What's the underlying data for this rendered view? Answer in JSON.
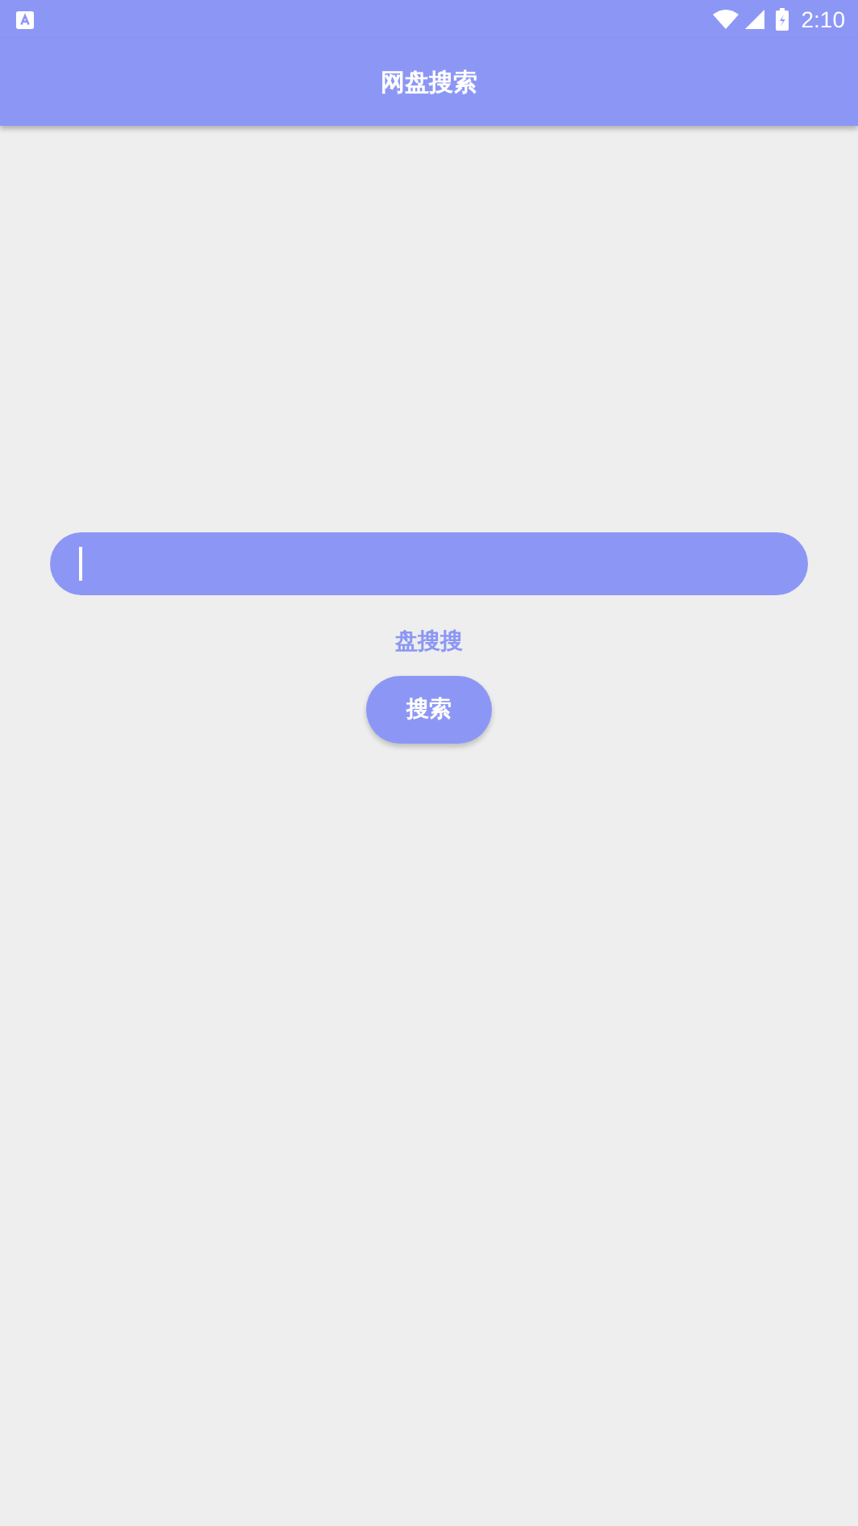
{
  "status_bar": {
    "time": "2:10"
  },
  "app_bar": {
    "title": "网盘搜索"
  },
  "search": {
    "focused": true
  },
  "engine": {
    "label": "盘搜搜"
  },
  "buttons": [
    {
      "label": "搜索"
    }
  ]
}
